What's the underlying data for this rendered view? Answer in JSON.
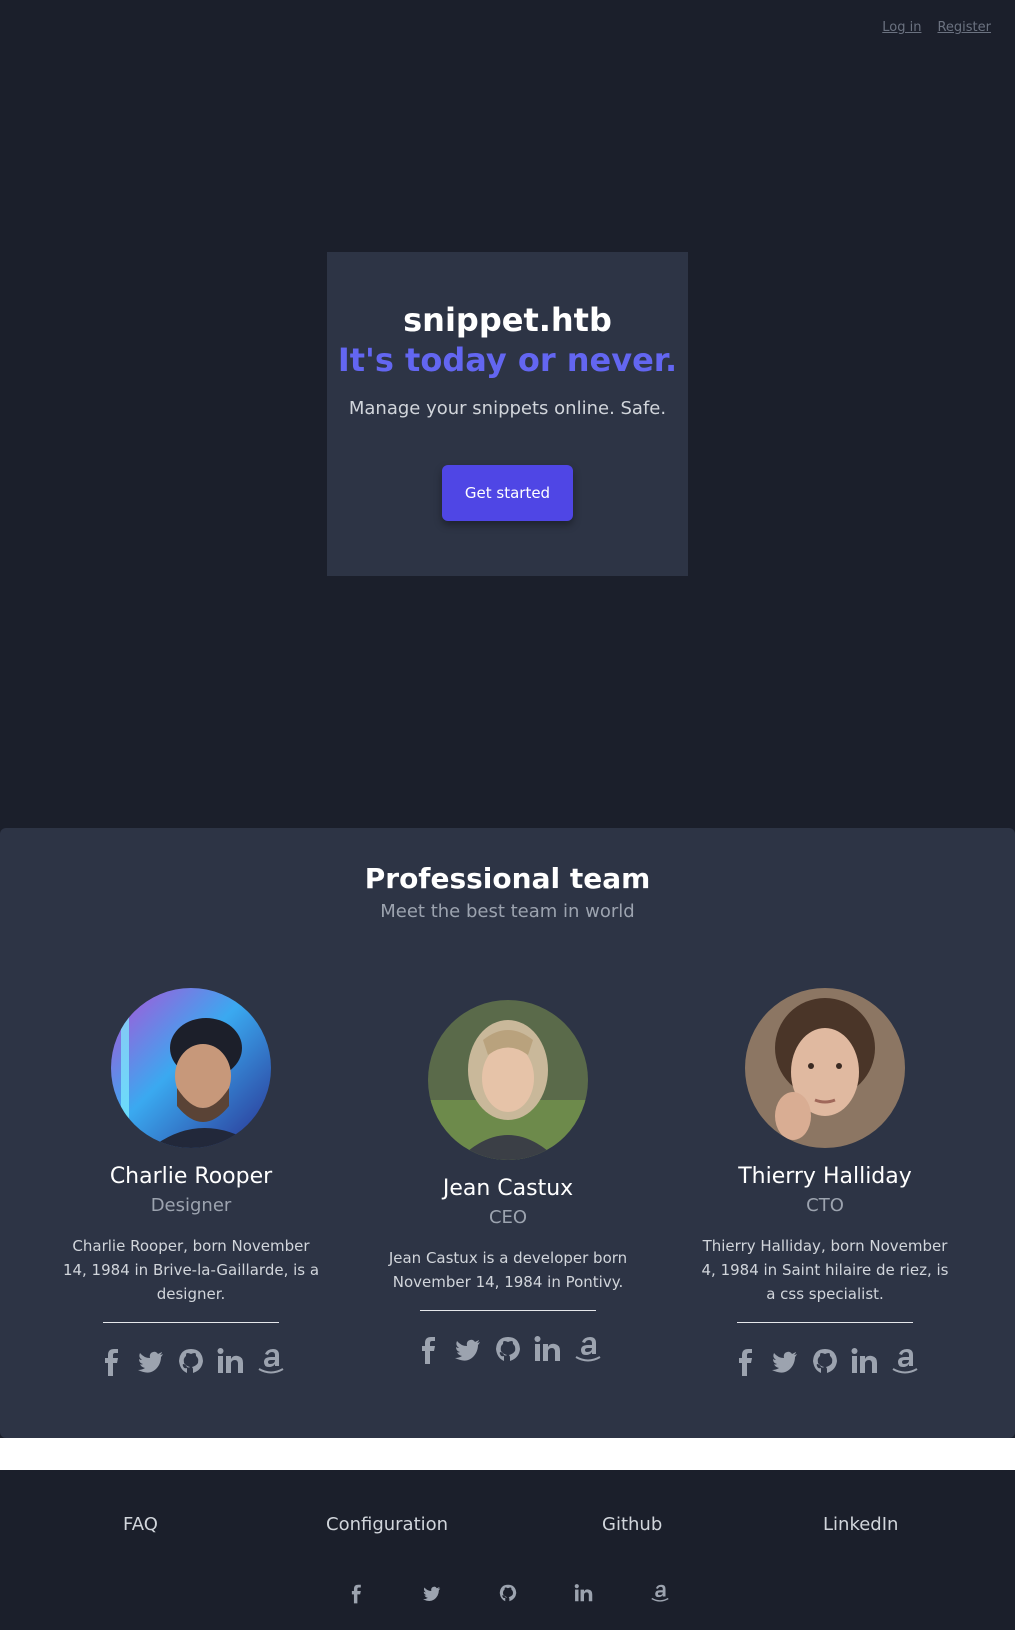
{
  "nav": {
    "login": "Log in",
    "register": "Register"
  },
  "hero": {
    "title": "snippet.htb",
    "tagline": "It's today or never.",
    "subtitle": "Manage your snippets online. Safe.",
    "cta": "Get started"
  },
  "team": {
    "title": "Professional team",
    "subtitle": "Meet the best team in world",
    "members": [
      {
        "name": "Charlie Rooper",
        "role": "Designer",
        "bio": "Charlie Rooper, born November 14, 1984 in Brive-la-Gaillarde, is a designer."
      },
      {
        "name": "Jean Castux",
        "role": "CEO",
        "bio": "Jean Castux is a developer born November 14, 1984 in Pontivy."
      },
      {
        "name": "Thierry Halliday",
        "role": "CTO",
        "bio": "Thierry Halliday, born November 4, 1984 in Saint hilaire de riez, is a css specialist."
      }
    ],
    "social_icons": [
      "facebook-icon",
      "twitter-icon",
      "github-icon",
      "linkedin-icon",
      "amazon-icon"
    ]
  },
  "footer": {
    "links": [
      "FAQ",
      "Configuration",
      "Github",
      "LinkedIn"
    ],
    "social_icons": [
      "facebook-icon",
      "twitter-icon",
      "github-icon",
      "linkedin-icon",
      "amazon-icon"
    ]
  },
  "colors": {
    "background": "#1b1f2b",
    "card": "#2d3445",
    "accent": "#6366f1",
    "button": "#4f46e5"
  }
}
